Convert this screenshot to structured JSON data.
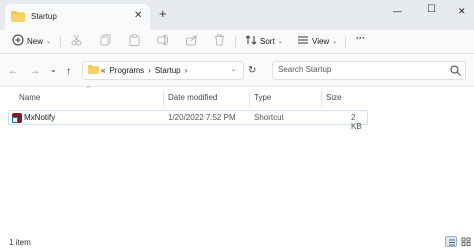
{
  "window": {
    "tab_title": "Startup",
    "new_tab_glyph": "+",
    "close_tab_glyph": "✕",
    "minimize_glyph": "—",
    "maximize_glyph": "☐",
    "close_glyph": "✕"
  },
  "toolbar": {
    "new_label": "New",
    "sort_label": "Sort",
    "view_label": "View",
    "more_glyph": "···",
    "icons": [
      "cut-icon",
      "copy-icon",
      "paste-icon",
      "rename-icon",
      "share-icon",
      "delete-icon"
    ]
  },
  "nav": {
    "back_glyph": "←",
    "forward_glyph": "→",
    "history_glyph": "⌄",
    "up_glyph": "↑",
    "refresh_glyph": "↻",
    "breadcrumb_overflow": "«",
    "breadcrumb": [
      "Programs",
      "Startup"
    ],
    "breadcrumb_sep": "›",
    "search_placeholder": "Search Startup"
  },
  "columns": {
    "name": "Name",
    "date": "Date modified",
    "type": "Type",
    "size": "Size",
    "sort_indicator": "^"
  },
  "files": [
    {
      "name": "MxNotify",
      "date": "1/20/2022 7:52 PM",
      "type": "Shortcut",
      "size": "2 KB",
      "icon": "shortcut-app-icon"
    }
  ],
  "status": {
    "item_count": "1 item"
  },
  "colors": {
    "accent": "#1e6fd0",
    "folder": "#f4c54a",
    "titlebar": "#e7eaef"
  }
}
